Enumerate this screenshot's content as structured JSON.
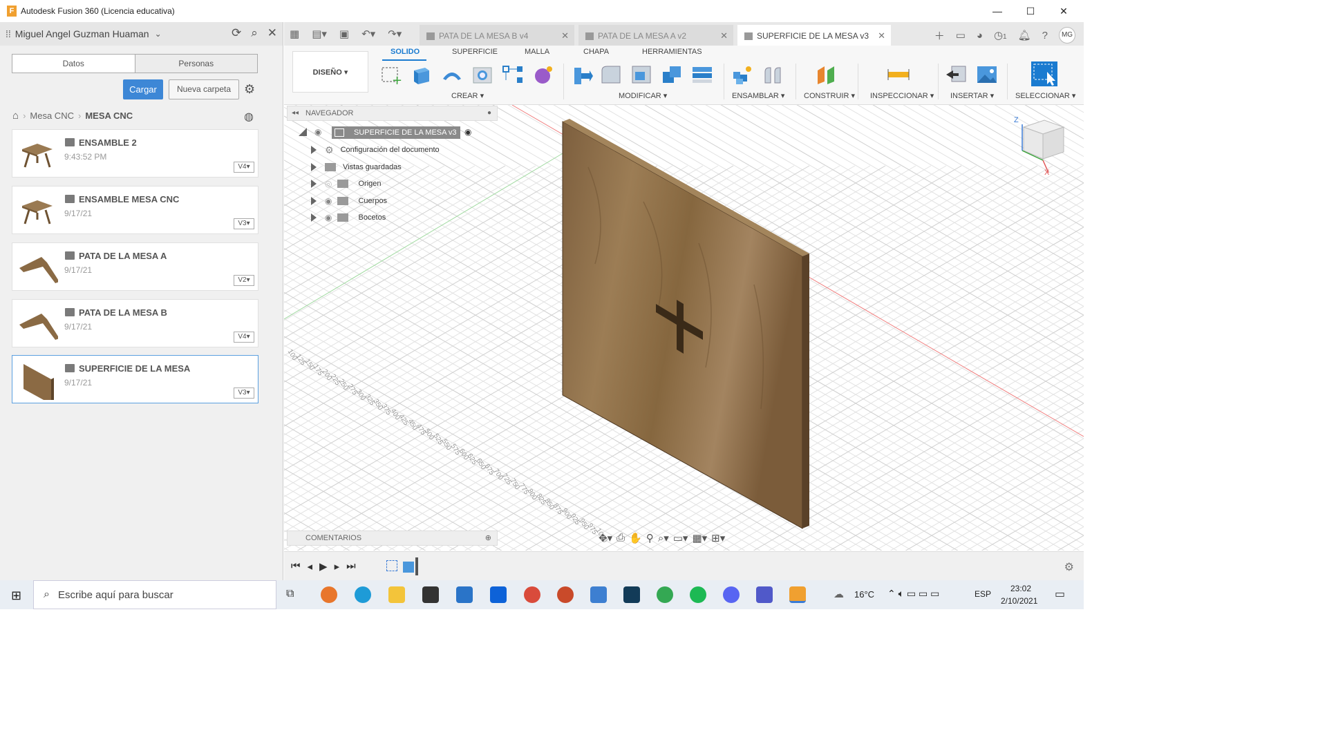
{
  "window": {
    "title": "Autodesk Fusion 360 (Licencia educativa)",
    "logo": "F"
  },
  "data_panel": {
    "user": "Miguel Angel Guzman Huaman",
    "tabs": [
      "Datos",
      "Personas"
    ],
    "upload_label": "Cargar",
    "new_folder_label": "Nueva carpeta",
    "breadcrumb": [
      "Mesa CNC",
      "MESA CNC"
    ],
    "items": [
      {
        "name": "ENSAMBLE 2",
        "date": "9:43:52 PM",
        "version": "V4"
      },
      {
        "name": "ENSAMBLE MESA CNC",
        "date": "9/17/21",
        "version": "V3"
      },
      {
        "name": "PATA DE LA MESA A",
        "date": "9/17/21",
        "version": "V2"
      },
      {
        "name": "PATA DE LA MESA B",
        "date": "9/17/21",
        "version": "V4"
      },
      {
        "name": "SUPERFICIE DE LA MESA",
        "date": "9/17/21",
        "version": "V3"
      }
    ]
  },
  "doc_tabs": [
    {
      "label": "PATA DE LA MESA B v4"
    },
    {
      "label": "PATA DE LA MESA A v2"
    },
    {
      "label": "SUPERFICIE DE LA MESA v3"
    }
  ],
  "tab_counter": "1",
  "user_initials": "MG",
  "ribbon": {
    "workspace": "DISEÑO",
    "tabs": [
      "SOLIDO",
      "SUPERFICIE",
      "MALLA",
      "CHAPA",
      "HERRAMIENTAS"
    ],
    "groups": [
      "CREAR",
      "MODIFICAR",
      "ENSAMBLAR",
      "CONSTRUIR",
      "INSPECCIONAR",
      "INSERTAR",
      "SELECCIONAR"
    ]
  },
  "navigator": {
    "title": "NAVEGADOR",
    "root": "SUPERFICIE DE LA MESA v3",
    "items": [
      "Configuración del documento",
      "Vistas guardadas",
      "Origen",
      "Cuerpos",
      "Bocetos"
    ]
  },
  "comments_title": "COMENTARIOS",
  "viewcube": {
    "axis_z": "Z",
    "axis_x": "X"
  },
  "grid_labels_left": [
    "100",
    "125",
    "150",
    "175",
    "200",
    "225",
    "250",
    "275",
    "300",
    "325",
    "350",
    "375",
    "400",
    "425",
    "450",
    "475",
    "500",
    "525",
    "550",
    "575",
    "600",
    "625",
    "650",
    "675",
    "700",
    "725",
    "750",
    "775",
    "800",
    "825",
    "850",
    "875",
    "900",
    "925",
    "950",
    "975",
    "1000"
  ],
  "taskbar": {
    "search_placeholder": "Escribe aquí para buscar",
    "temperature": "16°C",
    "language": "ESP",
    "time": "23:02",
    "date": "2/10/2021"
  },
  "colors": {
    "accent": "#1a7bd0",
    "upload_button": "#3d87d6",
    "wood": "#8b6a44"
  }
}
